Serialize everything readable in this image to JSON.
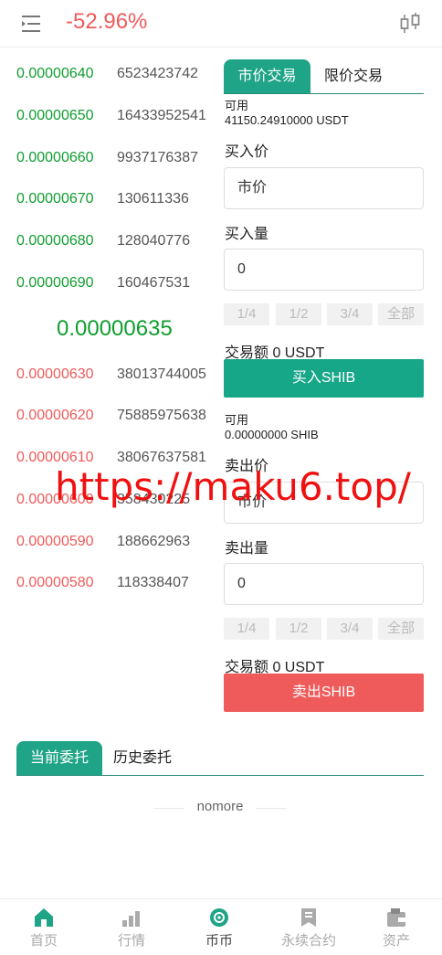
{
  "header": {
    "change_pct": "-52.96%"
  },
  "orderbook": {
    "asks": [
      {
        "price": "0.00000640",
        "qty": "6523423742"
      },
      {
        "price": "0.00000650",
        "qty": "16433952541"
      },
      {
        "price": "0.00000660",
        "qty": "9937176387"
      },
      {
        "price": "0.00000670",
        "qty": "130611336"
      },
      {
        "price": "0.00000680",
        "qty": "128040776"
      },
      {
        "price": "0.00000690",
        "qty": "160467531"
      }
    ],
    "last_price": "0.00000635",
    "bids": [
      {
        "price": "0.00000630",
        "qty": "38013744005"
      },
      {
        "price": "0.00000620",
        "qty": "75885975638"
      },
      {
        "price": "0.00000610",
        "qty": "38067637581"
      },
      {
        "price": "0.00000600",
        "qty": "358430225"
      },
      {
        "price": "0.00000590",
        "qty": "188662963"
      },
      {
        "price": "0.00000580",
        "qty": "118338407"
      }
    ]
  },
  "trade": {
    "tab_market": "市价交易",
    "tab_limit": "限价交易",
    "buy": {
      "available_label": "可用",
      "available_value": "41150.24910000 USDT",
      "price_label": "买入价",
      "price_value": "市价",
      "amount_label": "买入量",
      "amount_value": "0",
      "ratios": [
        "1/4",
        "1/2",
        "3/4",
        "全部"
      ],
      "total": "交易额 0 USDT",
      "button": "买入SHIB"
    },
    "sell": {
      "available_label": "可用",
      "available_value": "0.00000000 SHIB",
      "price_label": "卖出价",
      "price_value": "市价",
      "amount_label": "卖出量",
      "amount_value": "0",
      "ratios": [
        "1/4",
        "1/2",
        "3/4",
        "全部"
      ],
      "total": "交易额 0 USDT",
      "button": "卖出SHIB"
    }
  },
  "orders": {
    "tab_current": "当前委托",
    "tab_history": "历史委托",
    "empty_text": "nomore"
  },
  "watermark": "https://maku6.top/",
  "nav": [
    {
      "label": "首页",
      "icon": "home-icon"
    },
    {
      "label": "行情",
      "icon": "market-icon"
    },
    {
      "label": "币币",
      "icon": "coin-icon"
    },
    {
      "label": "永续合约",
      "icon": "contract-icon"
    },
    {
      "label": "资产",
      "icon": "assets-icon"
    }
  ],
  "colors": {
    "up": "#0f9d2f",
    "down": "#ef5a5a",
    "accent": "#1fa487"
  }
}
